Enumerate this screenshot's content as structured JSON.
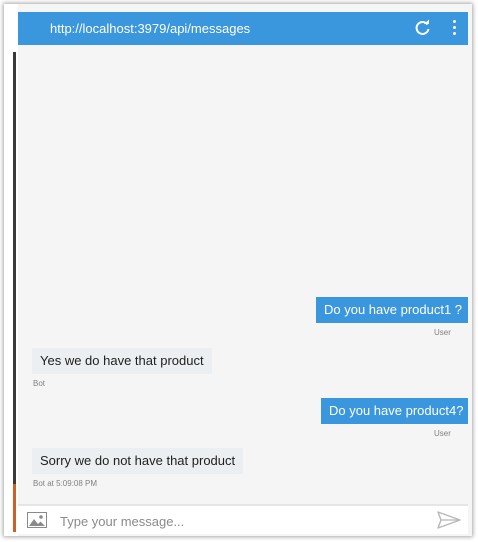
{
  "window": {
    "url": "http://localhost:3979/api/messages",
    "refresh_icon": "refresh-icon",
    "menu_icon": "more-vertical-icon"
  },
  "colors": {
    "accent": "#3a96dd",
    "bot_bubble": "#eceff1",
    "background": "#f5f5f5"
  },
  "messages": [
    {
      "from": "user",
      "text": "Do you have product1 ?",
      "meta": "User"
    },
    {
      "from": "bot",
      "text": "Yes we do have that product",
      "meta": "Bot"
    },
    {
      "from": "user",
      "text": "Do you have product4?",
      "meta": "User"
    },
    {
      "from": "bot",
      "text": "Sorry we do not have that product",
      "meta": "Bot at 5:09:08 PM"
    }
  ],
  "input": {
    "placeholder": "Type your message...",
    "value": "",
    "image_icon": "image-upload-icon",
    "send_icon": "send-icon"
  }
}
